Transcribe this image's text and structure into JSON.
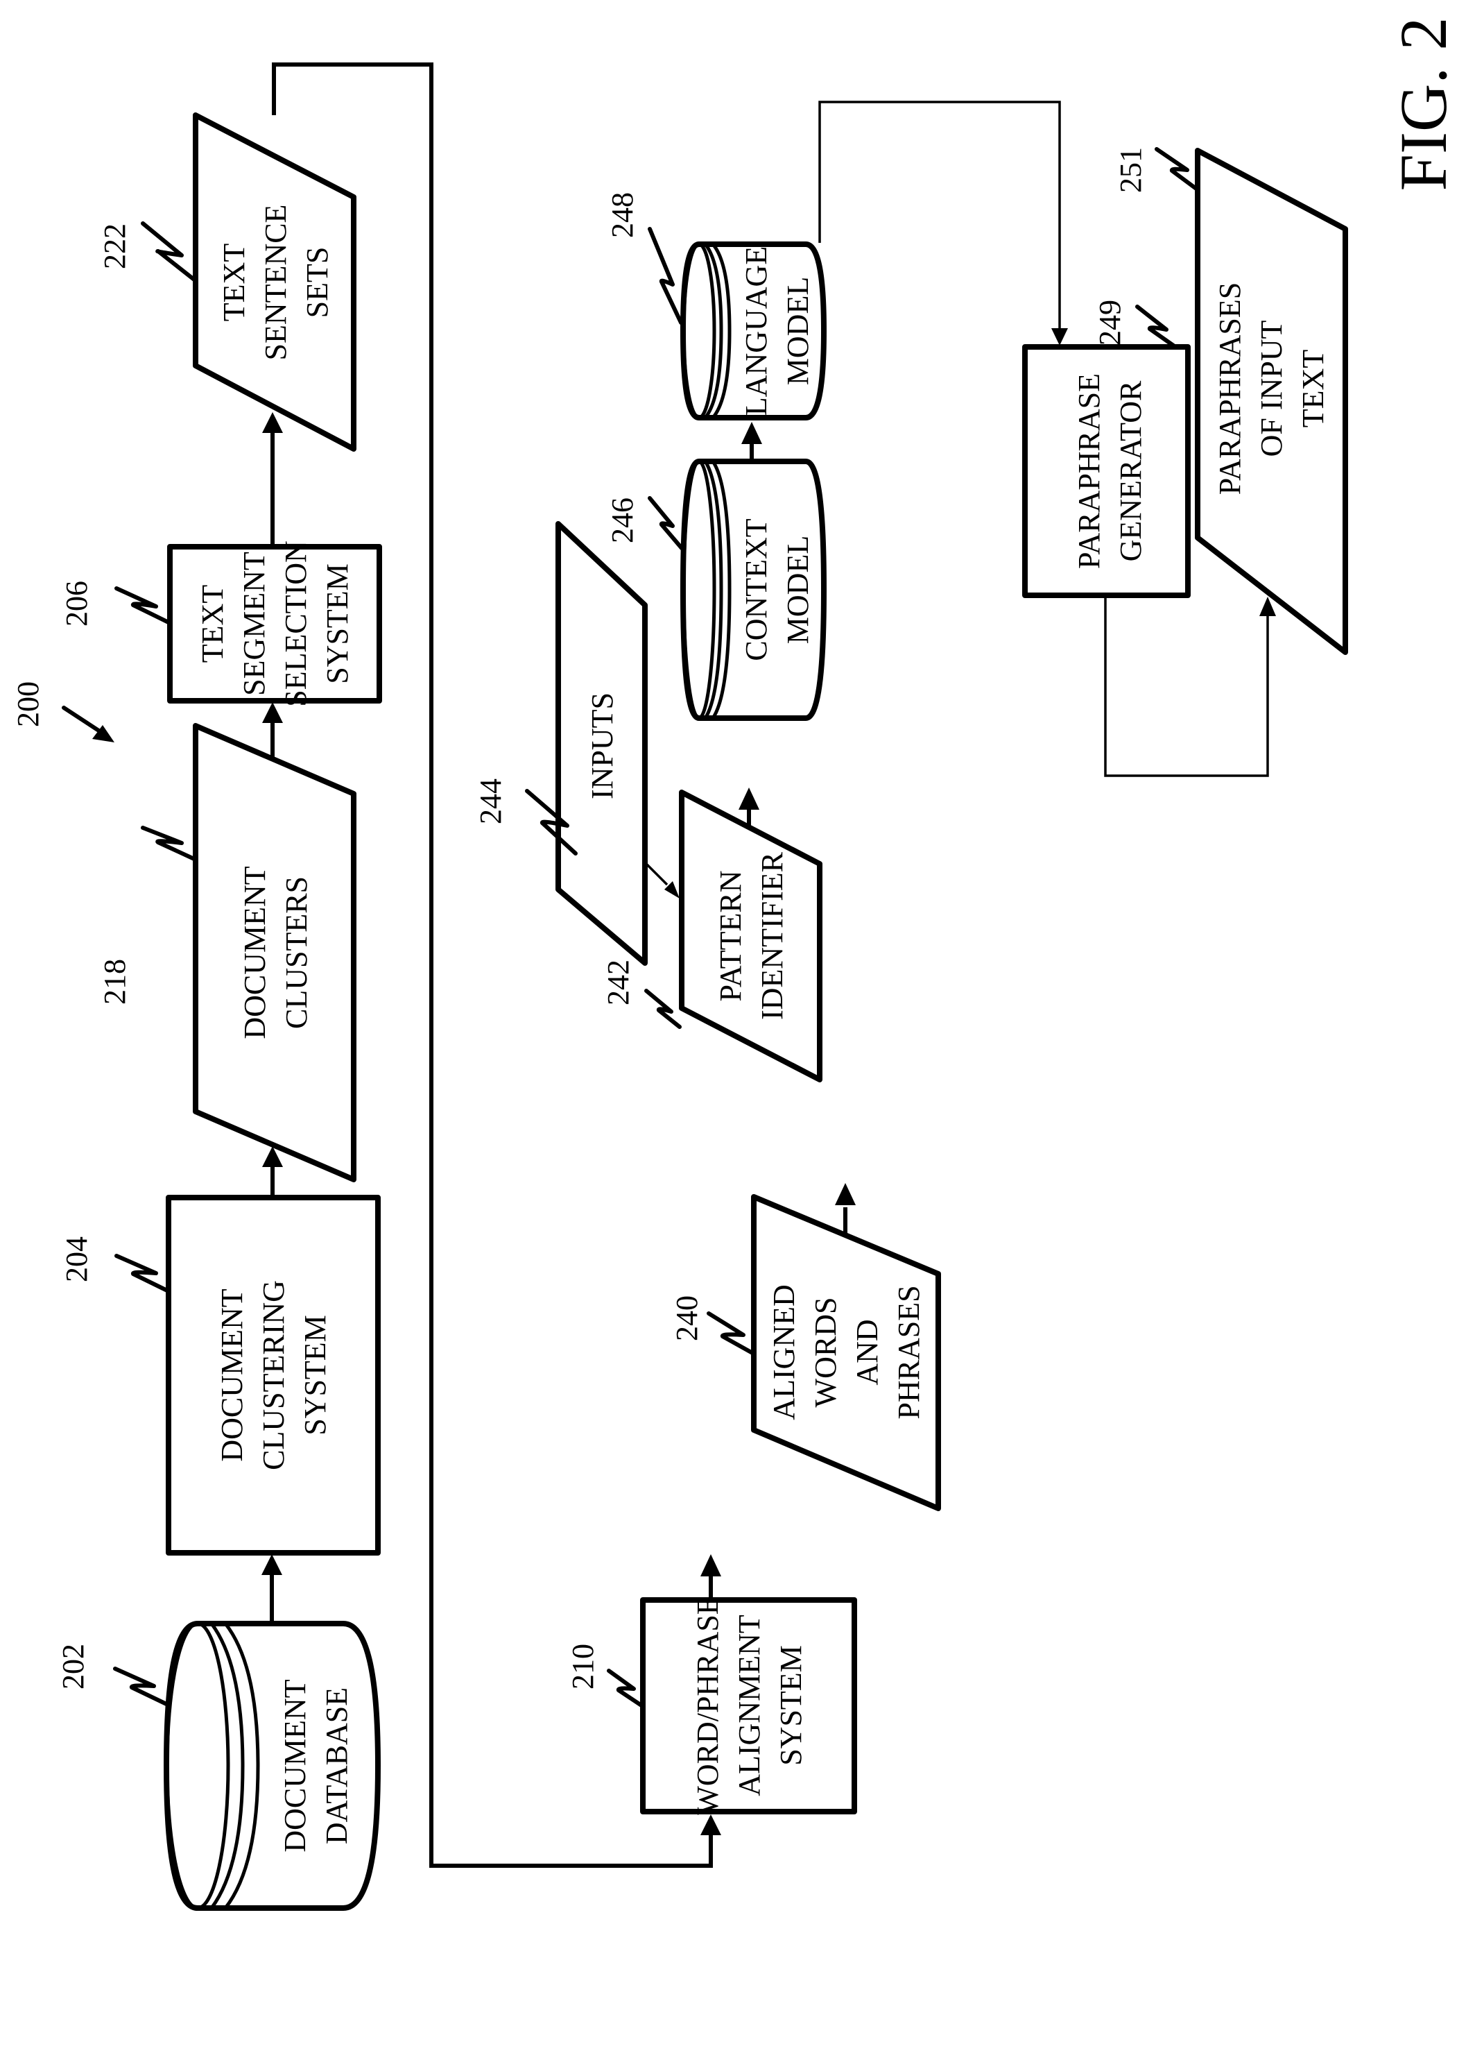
{
  "figure": {
    "title": "FIG. 2",
    "system_ref": "200"
  },
  "nodes": [
    {
      "id": "202",
      "shape": "cylinder",
      "lines": [
        "DOCUMENT",
        "DATABASE"
      ]
    },
    {
      "id": "204",
      "shape": "box",
      "lines": [
        "DOCUMENT",
        "CLUSTERING",
        "SYSTEM"
      ]
    },
    {
      "id": "218",
      "shape": "parallelogram",
      "lines": [
        "DOCUMENT",
        "CLUSTERS"
      ]
    },
    {
      "id": "206",
      "shape": "box",
      "lines": [
        "TEXT",
        "SEGMENT",
        "SELECTION",
        "SYSTEM"
      ]
    },
    {
      "id": "222",
      "shape": "parallelogram",
      "lines": [
        "TEXT",
        "SENTENCE",
        "SETS"
      ]
    },
    {
      "id": "210",
      "shape": "box",
      "lines": [
        "WORD/PHRASE",
        "ALIGNMENT",
        "SYSTEM"
      ]
    },
    {
      "id": "240",
      "shape": "parallelogram",
      "lines": [
        "ALIGNED",
        "WORDS",
        "AND",
        "PHRASES"
      ]
    },
    {
      "id": "242",
      "shape": "parallelogram",
      "lines": [
        "PATTERN",
        "IDENTIFIER"
      ]
    },
    {
      "id": "244",
      "shape": "parallelogram",
      "lines": [
        "INPUTS"
      ]
    },
    {
      "id": "246",
      "shape": "cylinder",
      "lines": [
        "CONTEXT",
        "MODEL"
      ]
    },
    {
      "id": "248",
      "shape": "cylinder",
      "lines": [
        "LANGUAGE",
        "MODEL"
      ]
    },
    {
      "id": "249",
      "shape": "box",
      "lines": [
        "PARAPHRASE",
        "GENERATOR"
      ]
    },
    {
      "id": "251",
      "shape": "parallelogram",
      "lines": [
        "PARAPHRASES",
        "OF INPUT",
        "TEXT"
      ]
    }
  ],
  "edges": [
    {
      "from": "202",
      "to": "204"
    },
    {
      "from": "204",
      "to": "218"
    },
    {
      "from": "218",
      "to": "206"
    },
    {
      "from": "206",
      "to": "222"
    },
    {
      "from": "222",
      "to": "210"
    },
    {
      "from": "210",
      "to": "240"
    },
    {
      "from": "240",
      "to": "242"
    },
    {
      "from": "244",
      "to": "242"
    },
    {
      "from": "242",
      "to": "246"
    },
    {
      "from": "246",
      "to": "248"
    },
    {
      "from": "248",
      "to": "249"
    },
    {
      "from": "249",
      "to": "251"
    }
  ]
}
